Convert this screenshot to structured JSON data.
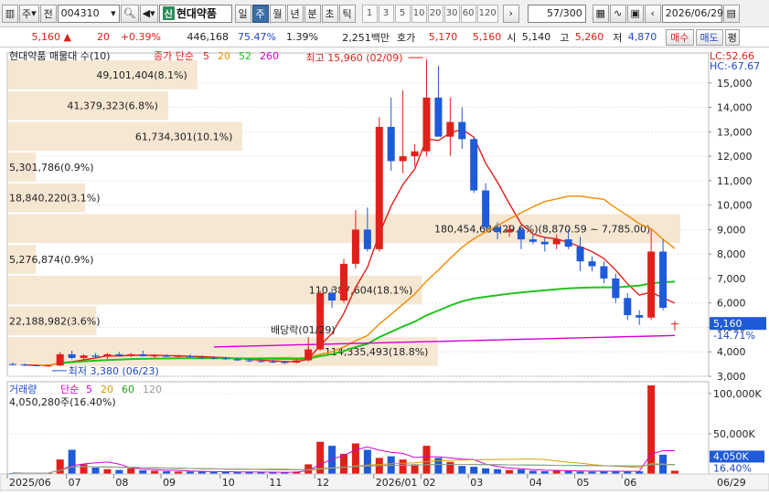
{
  "toolbar": {
    "type_label": "주",
    "type2_label": "전",
    "code": "004310",
    "name": "현대약품",
    "sin_badge": "신",
    "periods": [
      "일",
      "주",
      "월",
      "년",
      "분",
      "초",
      "틱"
    ],
    "active_period": "주",
    "nums": [
      "1",
      "3",
      "5",
      "10",
      "20",
      "30",
      "60",
      "120"
    ],
    "count": "57",
    "total": "/300",
    "date": "2026/06/29"
  },
  "quote": {
    "price": "5,160",
    "change": "20",
    "change_pct": "+0.39%",
    "volume": "446,168",
    "ratio1": "75.47%",
    "ratio2": "1.39%",
    "amount": "2,251백만",
    "hoga_label": "호가",
    "ask": "5,170",
    "bid": "5,160",
    "open_label": "시",
    "open": "5,140",
    "high_label": "고",
    "high": "5,260",
    "low_label": "저",
    "low": "4,870",
    "buy": "매수",
    "sell": "매도",
    "eval": "평"
  },
  "price_pane": {
    "legend_name": "현대약품 매물대 수(10)",
    "ma_label": "종가 단순",
    "ma_periods": [
      "5",
      "20",
      "52",
      "260"
    ],
    "ma_colors": [
      "#e0201b",
      "#f08c00",
      "#22c31e",
      "#d400d4"
    ],
    "lc_label": "LC:52.66",
    "hc_label": "HC:-67.67",
    "y_ticks": [
      "15,000",
      "14,000",
      "13,000",
      "12,000",
      "11,000",
      "10,000",
      "9,000",
      "8,000",
      "7,000",
      "6,000",
      "5,000",
      "4,000",
      "3,000"
    ],
    "current_price_tag": "5,160",
    "current_pct_tag": "-14.71%",
    "high_annotation": "최고 15,960 (02/09)",
    "low_annotation": "최저 3,380 (06/23)",
    "dividend_annotation": "배당락(01/29)",
    "range_annotation": "180,454,684(29.6%)(8,870.59 ~ 7,785.00)",
    "volume_profile": [
      "49,101,404(8.1%)",
      "41,379,323(6.8%)",
      "61,734,301(10.1%)",
      "5,301,786(0.9%)",
      "18,840,220(3.1%)",
      "",
      "5,276,874(0.9%)",
      "110,387,604(18.1%)",
      "22,188,982(3.6%)",
      "114,335,493(18.8%)"
    ]
  },
  "volume_pane": {
    "legend_name": "거래량",
    "ma_label": "단순",
    "ma_periods": [
      "5",
      "20",
      "60",
      "120"
    ],
    "ma_colors": [
      "#d400d4",
      "#d8a000",
      "#1fa01f",
      "#9a9a9a"
    ],
    "last_label": "4,050,280주(16.40%)",
    "y_ticks": [
      "100,000K",
      "50,000K"
    ],
    "current_tag": "4,050K",
    "pct_tag": "16.40%"
  },
  "x_axis": {
    "labels": [
      "2025/06",
      "07",
      "08",
      "09",
      "10",
      "11",
      "12",
      "2026/01",
      "02",
      "03",
      "04",
      "05",
      "06",
      "06/29"
    ]
  },
  "chart_data": {
    "type": "candlestick",
    "categories": [
      "2025/06/02",
      "06/09",
      "06/16",
      "06/23",
      "06/30",
      "07/07",
      "07/14",
      "07/21",
      "07/28",
      "08/04",
      "08/11",
      "08/18",
      "08/25",
      "09/01",
      "09/08",
      "09/15",
      "09/22",
      "09/29",
      "10/06",
      "10/13",
      "10/20",
      "10/27",
      "11/03",
      "11/10",
      "11/17",
      "11/24",
      "12/01",
      "12/08",
      "12/15",
      "12/22",
      "12/29",
      "2026/01/05",
      "01/12",
      "01/19",
      "01/26",
      "02/02",
      "02/09",
      "02/16",
      "02/23",
      "03/02",
      "03/09",
      "03/16",
      "03/23",
      "03/30",
      "04/06",
      "04/13",
      "04/20",
      "04/27",
      "05/04",
      "05/11",
      "05/18",
      "05/25",
      "06/01",
      "06/08",
      "06/15",
      "06/22",
      "06/29"
    ],
    "ohlc": [
      [
        3500,
        3560,
        3440,
        3480
      ],
      [
        3480,
        3520,
        3420,
        3450
      ],
      [
        3450,
        3480,
        3400,
        3430
      ],
      [
        3430,
        3460,
        3380,
        3440
      ],
      [
        3440,
        4000,
        3420,
        3900
      ],
      [
        3900,
        4050,
        3700,
        3750
      ],
      [
        3750,
        3900,
        3650,
        3850
      ],
      [
        3850,
        3950,
        3750,
        3800
      ],
      [
        3800,
        3950,
        3700,
        3900
      ],
      [
        3900,
        4000,
        3800,
        3850
      ],
      [
        3850,
        3950,
        3780,
        3900
      ],
      [
        3900,
        4050,
        3800,
        3820
      ],
      [
        3820,
        3900,
        3750,
        3850
      ],
      [
        3850,
        3900,
        3780,
        3800
      ],
      [
        3800,
        3860,
        3740,
        3830
      ],
      [
        3830,
        3900,
        3760,
        3780
      ],
      [
        3780,
        3850,
        3700,
        3760
      ],
      [
        3760,
        3820,
        3690,
        3740
      ],
      [
        3740,
        3800,
        3660,
        3700
      ],
      [
        3700,
        3760,
        3620,
        3650
      ],
      [
        3650,
        3720,
        3580,
        3620
      ],
      [
        3620,
        3700,
        3560,
        3600
      ],
      [
        3600,
        3680,
        3540,
        3580
      ],
      [
        3580,
        3640,
        3500,
        3560
      ],
      [
        3560,
        3700,
        3520,
        3650
      ],
      [
        3650,
        4200,
        3600,
        4100
      ],
      [
        4100,
        6500,
        4050,
        6400
      ],
      [
        6400,
        6600,
        5800,
        6100
      ],
      [
        6100,
        7800,
        6000,
        7600
      ],
      [
        7600,
        9800,
        7400,
        9000
      ],
      [
        9000,
        9900,
        8100,
        8200
      ],
      [
        8200,
        13600,
        8100,
        13200
      ],
      [
        13200,
        14400,
        11400,
        11800
      ],
      [
        11800,
        14700,
        11300,
        12000
      ],
      [
        12000,
        12500,
        11600,
        12200
      ],
      [
        12200,
        15960,
        12000,
        14400
      ],
      [
        14400,
        15700,
        13200,
        12800
      ],
      [
        12800,
        14400,
        12000,
        13400
      ],
      [
        13400,
        14000,
        12300,
        12700
      ],
      [
        12700,
        12800,
        10500,
        10600
      ],
      [
        10600,
        10900,
        9000,
        9100
      ],
      [
        9100,
        9300,
        8600,
        8900
      ],
      [
        8900,
        9200,
        8700,
        9000
      ],
      [
        9000,
        9100,
        8200,
        8600
      ],
      [
        8600,
        8800,
        8400,
        8500
      ],
      [
        8500,
        8700,
        8100,
        8400
      ],
      [
        8400,
        8800,
        8200,
        8600
      ],
      [
        8600,
        9000,
        8200,
        8300
      ],
      [
        8300,
        8700,
        7300,
        7700
      ],
      [
        7700,
        7900,
        7300,
        7500
      ],
      [
        7500,
        7700,
        6800,
        7000
      ],
      [
        7000,
        7200,
        6000,
        6200
      ],
      [
        6200,
        6400,
        5300,
        5500
      ],
      [
        5500,
        5700,
        5100,
        5400
      ],
      [
        5400,
        9000,
        5300,
        8100
      ],
      [
        8100,
        8600,
        5700,
        5800
      ],
      [
        5140,
        5260,
        4870,
        5160
      ]
    ],
    "volume_k": [
      1200,
      1100,
      1000,
      1300,
      18000,
      30000,
      12000,
      8000,
      6000,
      5000,
      7000,
      4500,
      4000,
      3500,
      3000,
      3000,
      2800,
      2500,
      2600,
      2400,
      2300,
      2200,
      2100,
      2000,
      3000,
      12000,
      40000,
      35000,
      25000,
      38000,
      30000,
      20000,
      22000,
      18000,
      12000,
      35000,
      20000,
      15000,
      10000,
      9000,
      7000,
      6000,
      5000,
      5500,
      4000,
      3500,
      4200,
      3800,
      3000,
      2800,
      3200,
      4000,
      3500,
      3300,
      110000,
      24000,
      4050
    ],
    "ylim": [
      3000,
      16000
    ],
    "volume_ylim": [
      0,
      110000
    ]
  }
}
